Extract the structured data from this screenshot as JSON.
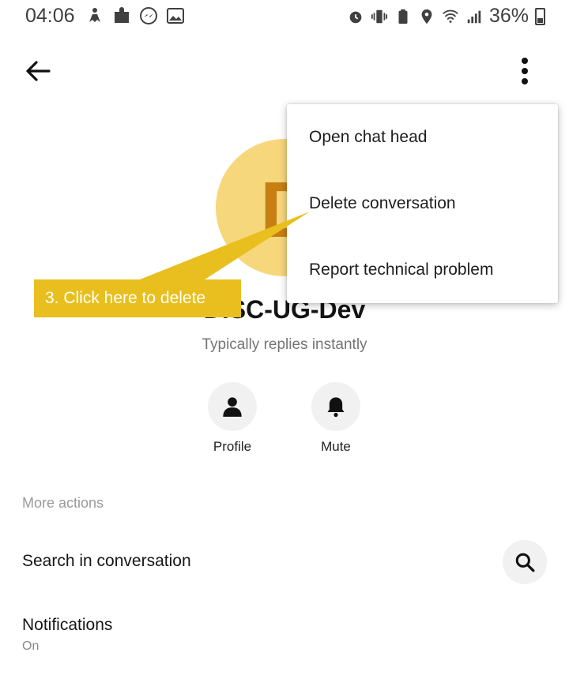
{
  "status_bar": {
    "time": "04:06",
    "battery": "36%",
    "left_icons": [
      "accessibility-icon",
      "extension-icon",
      "messenger-icon",
      "image-icon"
    ],
    "right_icons": [
      "alarm-icon",
      "vibrate-icon",
      "battery-saver-icon",
      "location-icon",
      "wifi-icon",
      "signal-icon",
      "battery-icon"
    ]
  },
  "toolbar": {
    "back_icon": "arrow-left-icon",
    "more_icon": "more-vertical-icon"
  },
  "conversation": {
    "avatar_letter": "D",
    "avatar_color": "#f6d77c",
    "title": "DISC-UG-Dev",
    "subtitle": "Typically replies instantly"
  },
  "actions": [
    {
      "label": "Profile",
      "icon": "person-icon"
    },
    {
      "label": "Mute",
      "icon": "bell-icon"
    }
  ],
  "more_actions": {
    "header": "More actions",
    "search_label": "Search in conversation",
    "notifications_label": "Notifications",
    "notifications_value": "On"
  },
  "menu": {
    "items": [
      "Open chat head",
      "Delete conversation",
      "Report technical problem"
    ]
  },
  "callout": {
    "text": "3. Click here to delete",
    "color": "#e8bf1f"
  }
}
